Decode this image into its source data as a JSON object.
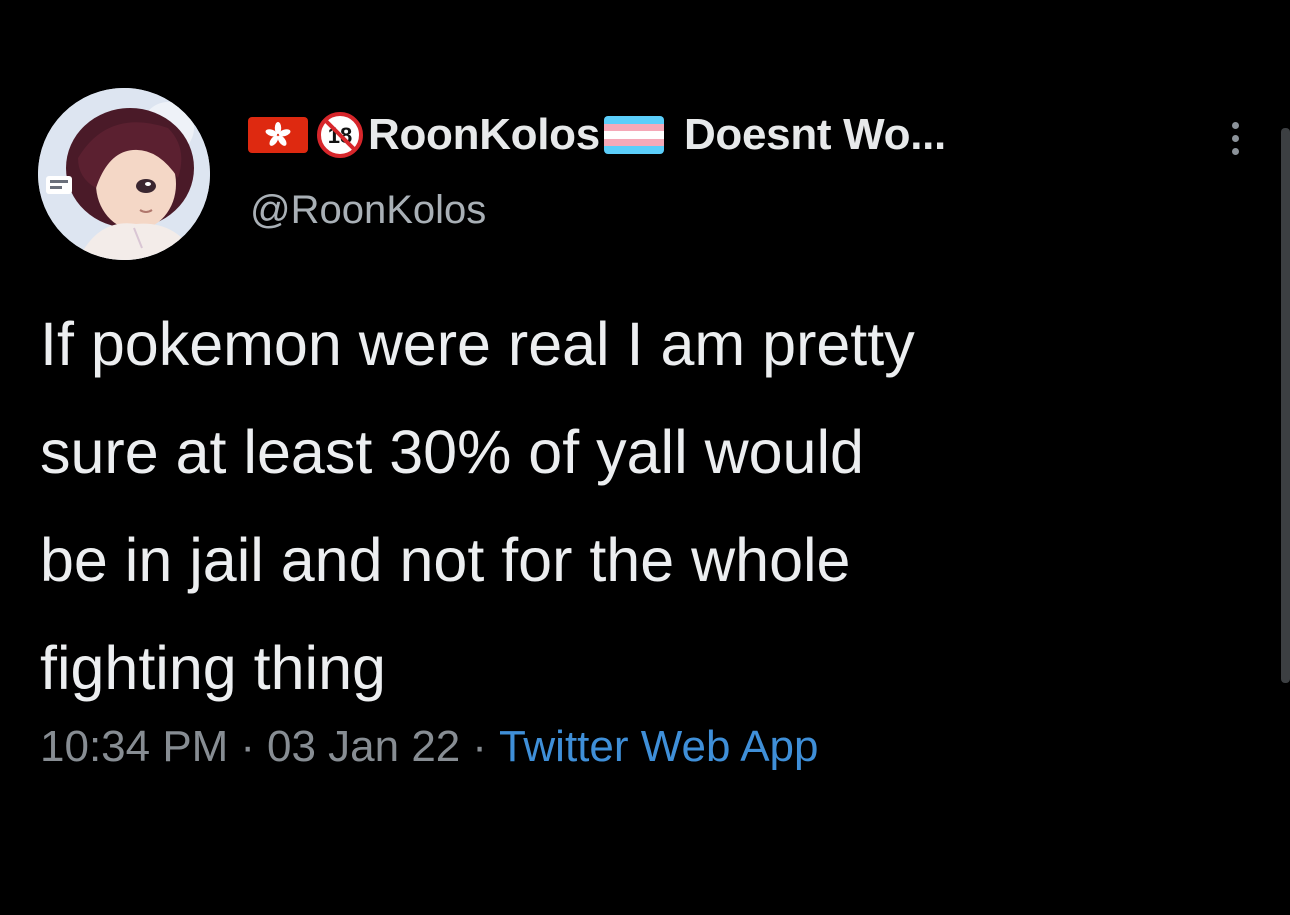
{
  "author": {
    "display_name": "RoonKolos",
    "display_name_suffix": "Doesnt Wo...",
    "handle": "@RoonKolos",
    "badges": [
      {
        "icon": "hong-kong-flag-icon"
      },
      {
        "icon": "no-under-18-icon",
        "text": "18"
      },
      {
        "icon": "transgender-flag-icon"
      }
    ]
  },
  "tweet": {
    "text": "If pokemon were real I am pretty\nsure at least 30% of yall would\nbe in jail and not for the whole\nfighting thing",
    "time": "10:34 PM",
    "date": "03 Jan 22",
    "separator": "·",
    "source": "Twitter Web App"
  },
  "colors": {
    "background": "#000000",
    "text": "#e7e9ea",
    "secondary_text": "#878d93",
    "link": "#3f8fd8",
    "hk_flag": "#de2910",
    "trans_blue": "#5bcefa",
    "trans_pink": "#f5a9b8",
    "trans_white": "#ffffff"
  },
  "icons": {
    "more": "more-vertical-icon",
    "avatar": "avatar-image"
  }
}
